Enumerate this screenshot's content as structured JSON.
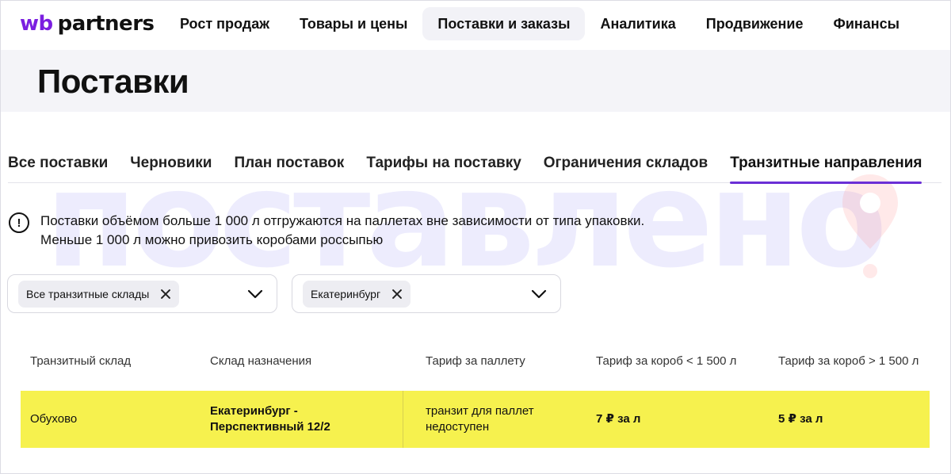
{
  "header": {
    "logo_wb": "wb",
    "logo_partners": "partners",
    "nav": [
      {
        "label": "Рост продаж"
      },
      {
        "label": "Товары и цены"
      },
      {
        "label": "Поставки и заказы"
      },
      {
        "label": "Аналитика"
      },
      {
        "label": "Продвижение"
      },
      {
        "label": "Финансы"
      }
    ],
    "active_nav": "Поставки и заказы"
  },
  "page_title": "Поставки",
  "watermark": "поставлено",
  "tabs": [
    {
      "label": "Все поставки"
    },
    {
      "label": "Черновики"
    },
    {
      "label": "План поставок"
    },
    {
      "label": "Тарифы на поставку"
    },
    {
      "label": "Ограничения складов"
    },
    {
      "label": "Транзитные направления"
    }
  ],
  "active_tab": "Транзитные направления",
  "notice": {
    "icon": "exclamation-circle-icon",
    "line1": "Поставки объёмом больше 1 000 л отгружаются на паллетах вне зависимости от типа упаковки.",
    "line2": "Меньше 1 000 л можно привозить коробами россыпью"
  },
  "filters": {
    "transit": {
      "chip": "Все транзитные склады"
    },
    "destination": {
      "chip": "Екатеринбург"
    }
  },
  "table": {
    "headers": [
      "Транзитный склад",
      "Склад назначения",
      "Тариф за паллету",
      "Тариф за короб < 1 500 л",
      "Тариф за короб > 1 500 л"
    ],
    "rows": [
      {
        "transit": "Обухово",
        "destination_line1": "Екатеринбург -",
        "destination_line2": "Перспективный 12/2",
        "pallet_line1": "транзит для паллет",
        "pallet_line2": "недоступен",
        "box_small": "7 ₽ за л",
        "box_large": "5 ₽ за л"
      }
    ]
  },
  "colors": {
    "accent": "#6b2fd6",
    "logo_wb": "#7b1fe0",
    "highlight_row": "#f6f14e",
    "title_band": "#f4f4f8"
  }
}
